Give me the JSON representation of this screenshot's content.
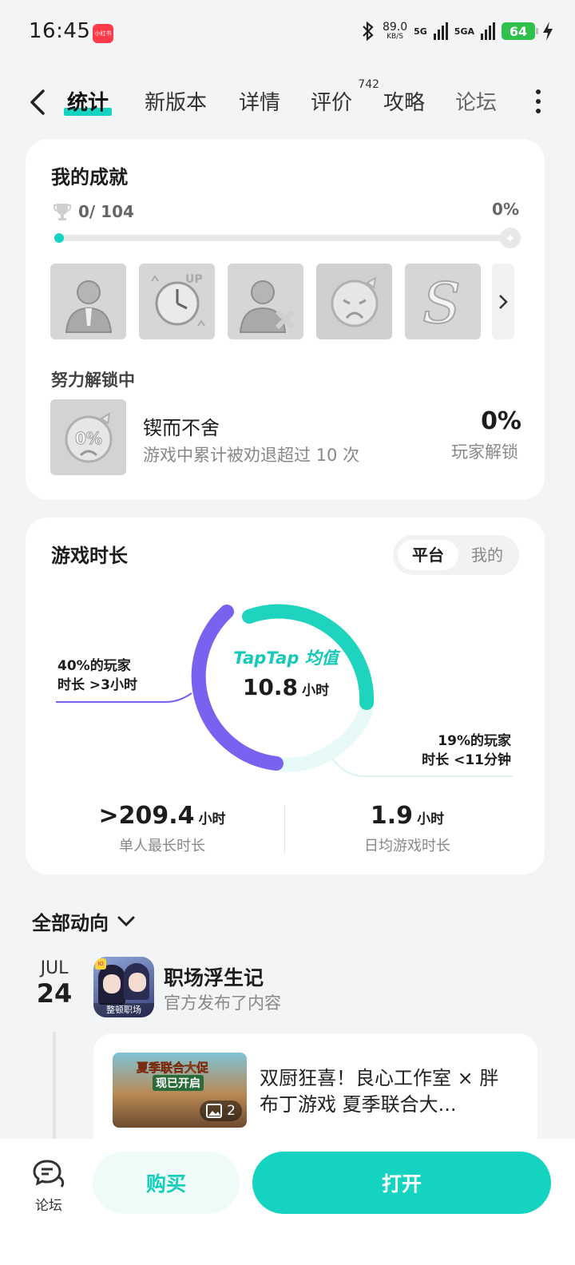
{
  "status_bar": {
    "time": "16:45",
    "app_badge": "小红书",
    "net_speed": "89.0",
    "net_unit": "KB/S",
    "net_type_1": "5G",
    "net_type_2": "5GA",
    "battery": "64"
  },
  "tabs": [
    {
      "label": "统计",
      "active": true
    },
    {
      "label": "新版本"
    },
    {
      "label": "详情"
    },
    {
      "label": "评价",
      "count": "742"
    },
    {
      "label": "攻略"
    },
    {
      "label": "论坛"
    }
  ],
  "achievements": {
    "title": "我的成就",
    "progress_text": "0/ 104",
    "progress_percent": "0%",
    "progress_fraction": 0.0,
    "badges": [
      "businessman-icon",
      "alarm-clock-up-icon",
      "businessman-cross-icon",
      "crying-face-icon",
      "letter-s-icon"
    ],
    "in_progress_title": "努力解锁中",
    "item": {
      "name": "锲而不舍",
      "desc": "游戏中累计被劝退超过 10 次",
      "percent": "0%",
      "percent_label": "玩家解锁",
      "badge_text": "0%"
    }
  },
  "playtime": {
    "title": "游戏时长",
    "toggle": {
      "on": "平台",
      "off": "我的"
    },
    "left_annotation_line1": "40%的玩家",
    "left_annotation_line2": "时长 >3小时",
    "right_annotation_line1": "19%的玩家",
    "right_annotation_line2": "时长 <11分钟",
    "center_brand": "TapTap 均值",
    "center_value": "10.8",
    "center_unit": "小时",
    "donut_colors": {
      "long": "#7763f0",
      "mid": "#1ed4bf",
      "short": "#e8faf7"
    },
    "stats": [
      {
        "value": ">209.4",
        "unit": "小时",
        "label": "单人最长时长"
      },
      {
        "value": "1.9",
        "unit": "小时",
        "label": "日均游戏时长"
      }
    ]
  },
  "feed": {
    "header": "全部动向",
    "date_month": "JUL",
    "date_day": "24",
    "game_name": "职场浮生记",
    "game_sub": "官方发布了内容",
    "icon_tag": "整顿职场",
    "post_text": "双厨狂喜！良心工作室 × 胖布丁游戏 夏季联合大...",
    "post_img_title": "夏季联合大促",
    "post_img_sub": "现已开启",
    "post_img_count": "2"
  },
  "bottom_bar": {
    "forum": "论坛",
    "buy": "购买",
    "open": "打开"
  },
  "accent_color": "#14d4c1"
}
